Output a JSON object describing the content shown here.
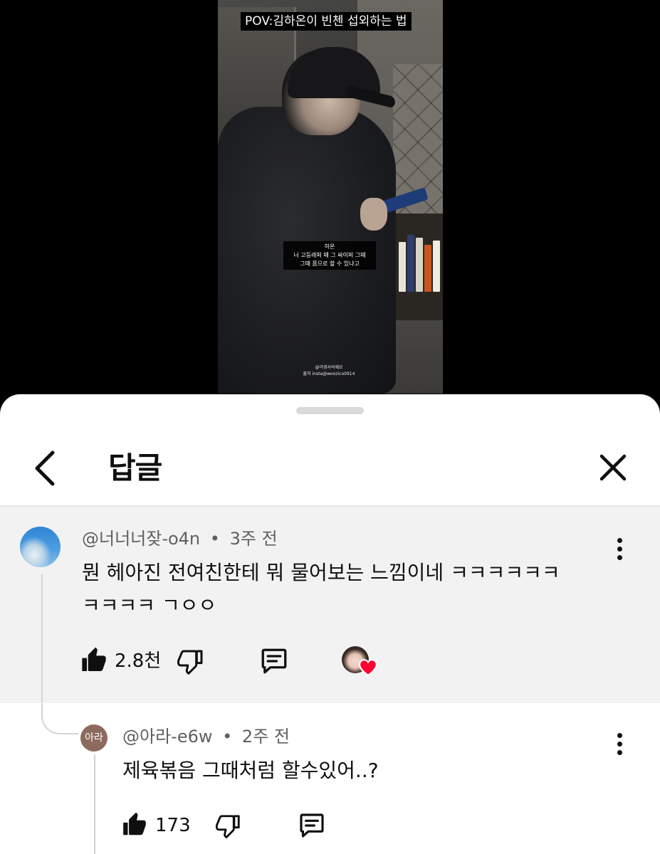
{
  "video": {
    "title": "POV:김하온이 빈첸 섭외하는 법",
    "caption_speaker": "하온",
    "caption_line1": "너 고등래퍼 때 그 싸이퍼 그때",
    "caption_line2": "그때 폼으로 할 수 있냐고",
    "watermark_line1": "@야영사비쉐요",
    "watermark_line2": "출처 insta@woozico0914"
  },
  "sheet": {
    "title": "답글",
    "back_icon": "chevron-left-icon",
    "close_icon": "close-icon"
  },
  "parent_comment": {
    "author": "@너너너잦-o4n",
    "separator": "•",
    "time": "3주 전",
    "text_line1": "뭔 헤아진 전여친한테 뭐 물어보는 느낌이네 ㅋㅋㅋㅋㅋㅋ",
    "text_line2": "ㅋㅋㅋㅋ ㄱㅇㅇ",
    "likes": "2.8천",
    "creator_heart": true
  },
  "reply": {
    "avatar_text": "아라",
    "author": "@아라-e6w",
    "separator": "•",
    "time": "2주 전",
    "text": "제육볶음 그때처럼 할수있어..?",
    "likes": "173"
  },
  "colors": {
    "accent_heart": "#ff0033",
    "highlight_bg": "#f2f2f2",
    "meta_text": "#606060"
  }
}
